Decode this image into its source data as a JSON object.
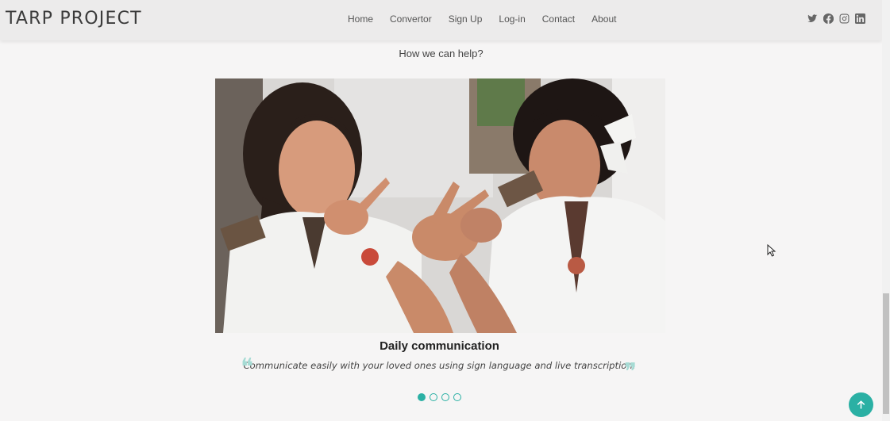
{
  "header": {
    "logo": "TARP PROJECT",
    "nav": [
      "Home",
      "Convertor",
      "Sign Up",
      "Log-in",
      "Contact",
      "About"
    ],
    "social_icons": [
      "twitter-icon",
      "facebook-icon",
      "instagram-icon",
      "linkedin-icon"
    ]
  },
  "section": {
    "subtitle": "How we can help?"
  },
  "carousel": {
    "image_description": "students-sign-language-photo",
    "slide_title": "Daily communication",
    "slide_text": "Communicate easily with your loved ones using sign language and live transcription.",
    "total_slides": 4,
    "active_slide": 1
  },
  "colors": {
    "accent": "#2bb0a4",
    "quote_mark": "#a6dbd4",
    "header_bg": "#ecebeb",
    "page_bg": "#f6f5f5"
  },
  "back_to_top_icon": "arrow-up-icon"
}
